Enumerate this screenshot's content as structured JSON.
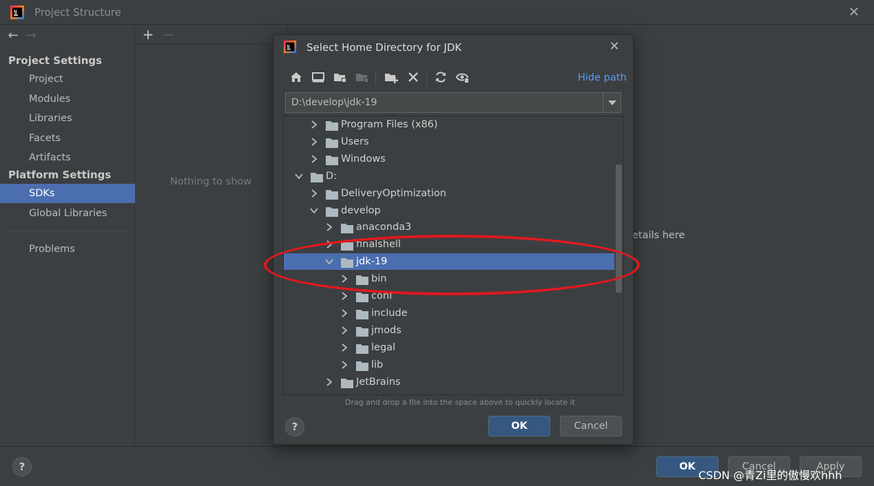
{
  "window": {
    "title": "Project Structure"
  },
  "sidebar": {
    "project_settings_heading": "Project Settings",
    "platform_settings_heading": "Platform Settings",
    "items": [
      {
        "label": "Project"
      },
      {
        "label": "Modules"
      },
      {
        "label": "Libraries"
      },
      {
        "label": "Facets"
      },
      {
        "label": "Artifacts"
      },
      {
        "label": "SDKs",
        "selected": true
      },
      {
        "label": "Global Libraries"
      },
      {
        "label": "Problems"
      }
    ]
  },
  "center_panel": {
    "empty_text": "Nothing to show"
  },
  "right_panel": {
    "partial_text": "etails here"
  },
  "bottom": {
    "ok_label": "OK",
    "cancel_label": "Cancel",
    "apply_label": "Apply",
    "help_label": "?"
  },
  "watermark": "CSDN @青Zi里的傲慢欢hhh",
  "dialog": {
    "title": "Select Home Directory for JDK",
    "hide_path_label": "Hide path",
    "path_value": "D:\\develop\\jdk-19",
    "drag_hint": "Drag and drop a file into the space above to quickly locate it",
    "ok_label": "OK",
    "cancel_label": "Cancel",
    "help_label": "?",
    "toolbar": [
      "home-icon",
      "desktop-icon",
      "project-folder-icon",
      "module-folder-icon",
      "new-folder-icon",
      "delete-icon",
      "refresh-icon",
      "show-hidden-icon"
    ],
    "tree": [
      {
        "label": "Program Files (x86)",
        "level": 1,
        "expanded": false
      },
      {
        "label": "Users",
        "level": 1,
        "expanded": false
      },
      {
        "label": "Windows",
        "level": 1,
        "expanded": false
      },
      {
        "label": "D:",
        "level": 0,
        "expanded": true
      },
      {
        "label": "DeliveryOptimization",
        "level": 1,
        "expanded": false
      },
      {
        "label": "develop",
        "level": 1,
        "expanded": true
      },
      {
        "label": "anaconda3",
        "level": 2,
        "expanded": false
      },
      {
        "label": "finalshell",
        "level": 2,
        "expanded": false
      },
      {
        "label": "jdk-19",
        "level": 2,
        "expanded": true,
        "selected": true
      },
      {
        "label": "bin",
        "level": 3,
        "expanded": false
      },
      {
        "label": "conf",
        "level": 3,
        "expanded": false
      },
      {
        "label": "include",
        "level": 3,
        "expanded": false
      },
      {
        "label": "jmods",
        "level": 3,
        "expanded": false
      },
      {
        "label": "legal",
        "level": 3,
        "expanded": false
      },
      {
        "label": "lib",
        "level": 3,
        "expanded": false
      },
      {
        "label": "JetBrains",
        "level": 2,
        "expanded": false
      }
    ]
  },
  "colors": {
    "accent_selection": "#4b6eaf",
    "link": "#589df6",
    "highlight_ellipse": "#e0191f"
  }
}
